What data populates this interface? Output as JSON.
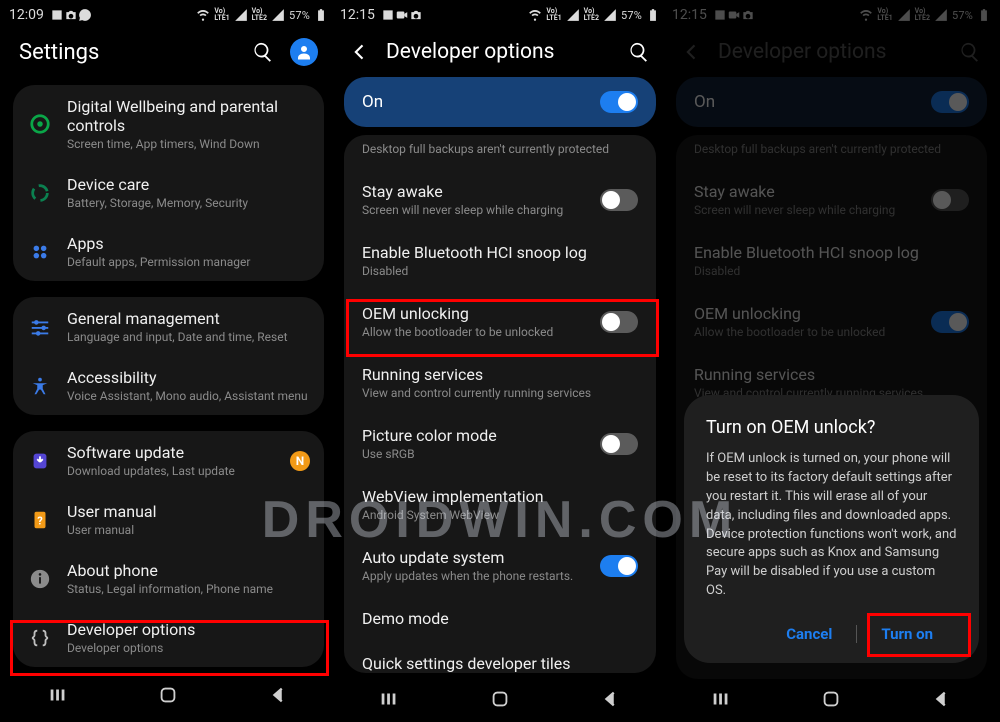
{
  "status1": {
    "clock": "12:09",
    "battery": "57%"
  },
  "status23": {
    "clock": "12:15",
    "battery": "57%"
  },
  "sb_net": "Vo) LTE1↕ Vo) LTE2↕",
  "settings_title": "Settings",
  "dev_title": "Developer options",
  "groupA": [
    {
      "icon": "wellbeing",
      "title": "Digital Wellbeing and parental controls",
      "sub": "Screen time, App timers, Wind Down"
    },
    {
      "icon": "devicecare",
      "title": "Device care",
      "sub": "Battery, Storage, Memory, Security"
    },
    {
      "icon": "apps",
      "title": "Apps",
      "sub": "Default apps, Permission manager"
    }
  ],
  "groupB": [
    {
      "icon": "genmgmt",
      "title": "General management",
      "sub": "Language and input, Date and time, Reset"
    },
    {
      "icon": "a11y",
      "title": "Accessibility",
      "sub": "Voice Assistant, Mono audio, Assistant menu"
    }
  ],
  "groupC": [
    {
      "icon": "swupdate",
      "title": "Software update",
      "sub": "Download updates, Last update",
      "dot": true
    },
    {
      "icon": "manual",
      "title": "User manual",
      "sub": "User manual"
    },
    {
      "icon": "about",
      "title": "About phone",
      "sub": "Status, Legal information, Phone name"
    },
    {
      "icon": "devopts",
      "title": "Developer options",
      "sub": "Developer options"
    }
  ],
  "on_label": "On",
  "devlist_top_sub": "Desktop full backups aren't currently protected",
  "devlist": [
    {
      "title": "Stay awake",
      "sub": "Screen will never sleep while charging",
      "toggle": false
    },
    {
      "title": "Enable Bluetooth HCI snoop log",
      "sub": "Disabled"
    },
    {
      "title": "OEM unlocking",
      "sub": "Allow the bootloader to be unlocked",
      "toggle": false
    },
    {
      "title": "Running services",
      "sub": "View and control currently running services"
    },
    {
      "title": "Picture color mode",
      "sub": "Use sRGB",
      "toggle": false
    },
    {
      "title": "WebView implementation",
      "sub": "Android System WebView"
    },
    {
      "title": "Auto update system",
      "sub": "Apply updates when the phone restarts.",
      "toggle": true
    },
    {
      "title": "Demo mode"
    },
    {
      "title": "Quick settings developer tiles"
    }
  ],
  "dialog": {
    "title": "Turn on OEM unlock?",
    "body": "If OEM unlock is turned on, your phone will be reset to its factory default settings after you restart it. This will erase all of your data, including files and downloaded apps. Device protection functions won't work, and secure apps such as Knox and Samsung Pay will be disabled if you use a custom OS.",
    "cancel": "Cancel",
    "turnon": "Turn on"
  },
  "watermark": "DROIDWIN.COM"
}
